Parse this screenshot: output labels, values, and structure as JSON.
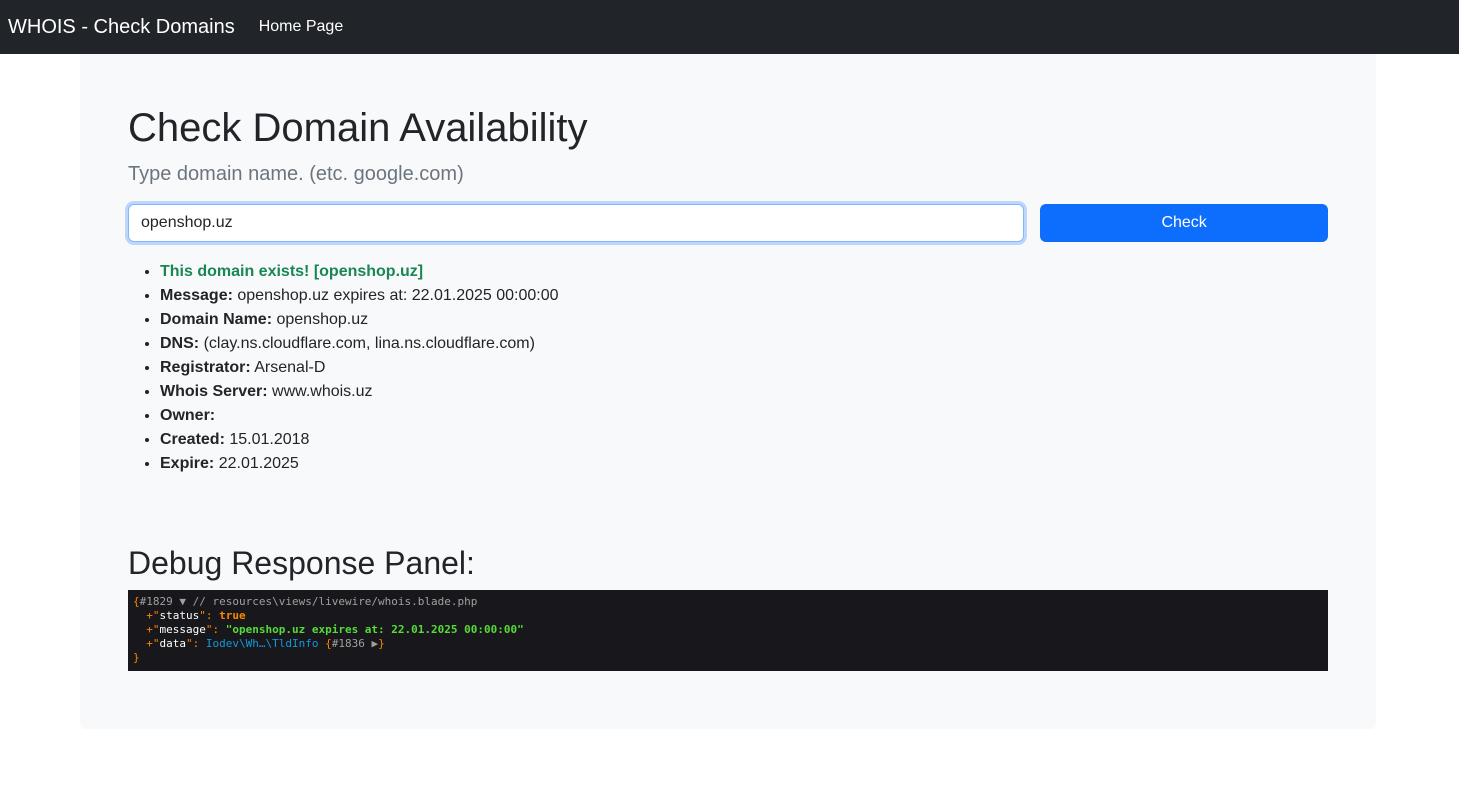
{
  "navbar": {
    "brand": "WHOIS - Check Domains",
    "home_link": "Home Page"
  },
  "main": {
    "title": "Check Domain Availability",
    "subtitle": "Type domain name. (etc. google.com)",
    "input_value": "openshop.uz",
    "check_label": "Check"
  },
  "result": {
    "status_text": "This domain exists! [openshop.uz]",
    "items": [
      {
        "label": "Message:",
        "value": "openshop.uz expires at: 22.01.2025 00:00:00"
      },
      {
        "label": "Domain Name:",
        "value": "openshop.uz"
      },
      {
        "label": "DNS:",
        "value": "(clay.ns.cloudflare.com, lina.ns.cloudflare.com)"
      },
      {
        "label": "Registrator:",
        "value": "Arsenal-D"
      },
      {
        "label": "Whois Server:",
        "value": "www.whois.uz"
      },
      {
        "label": "Owner:",
        "value": ""
      },
      {
        "label": "Created:",
        "value": "15.01.2018"
      },
      {
        "label": "Expire:",
        "value": "22.01.2025"
      }
    ]
  },
  "debug": {
    "title": "Debug Response Panel:",
    "open_brace": "{",
    "object_id": "#1829",
    "toggle": "▼",
    "path_note": "// resources\\views/livewire/whois.blade.php",
    "status_key": "status",
    "status_value": "true",
    "message_key": "message",
    "message_value": "\"openshop.uz expires at: 22.01.2025 00:00:00\"",
    "data_key": "data",
    "data_class": "Iodev\\Wh…\\TldInfo",
    "data_ref": "#1836",
    "data_toggle": "▶",
    "close_brace": "}"
  },
  "colors": {
    "navbar_bg": "#212529",
    "primary": "#0d6efd",
    "success": "#198754",
    "panel_bg": "#f8f9fa",
    "debug_bg": "#18171b"
  }
}
